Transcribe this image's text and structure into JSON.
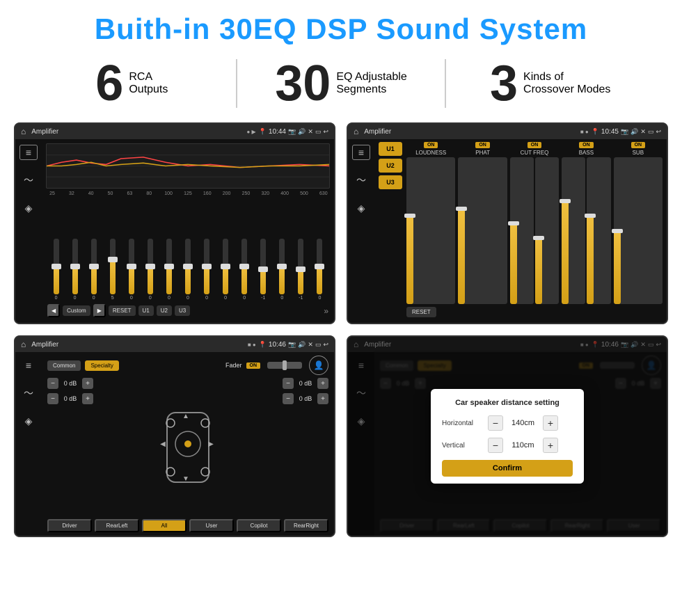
{
  "header": {
    "title": "Buith-in 30EQ DSP Sound System"
  },
  "stats": [
    {
      "number": "6",
      "text_line1": "RCA",
      "text_line2": "Outputs"
    },
    {
      "number": "30",
      "text_line1": "EQ Adjustable",
      "text_line2": "Segments"
    },
    {
      "number": "3",
      "text_line1": "Kinds of",
      "text_line2": "Crossover Modes"
    }
  ],
  "screens": {
    "top_left": {
      "title": "Amplifier",
      "time": "10:44",
      "eq_freqs": [
        "25",
        "32",
        "40",
        "50",
        "63",
        "80",
        "100",
        "125",
        "160",
        "200",
        "250",
        "320",
        "400",
        "500",
        "630"
      ],
      "eq_values": [
        "0",
        "0",
        "0",
        "5",
        "0",
        "0",
        "0",
        "0",
        "0",
        "0",
        "0",
        "-1",
        "0",
        "-1",
        "0"
      ],
      "buttons": [
        "Custom",
        "RESET",
        "U1",
        "U2",
        "U3"
      ]
    },
    "top_right": {
      "title": "Amplifier",
      "time": "10:45",
      "presets": [
        "U1",
        "U2",
        "U3"
      ],
      "panels": [
        {
          "on": true,
          "label": "LOUDNESS"
        },
        {
          "on": true,
          "label": "PHAT"
        },
        {
          "on": true,
          "label": "CUT FREQ"
        },
        {
          "on": true,
          "label": "BASS"
        },
        {
          "on": true,
          "label": "SUB"
        }
      ],
      "reset_btn": "RESET"
    },
    "bottom_left": {
      "title": "Amplifier",
      "time": "10:46",
      "tabs": [
        "Common",
        "Specialty"
      ],
      "active_tab": "Specialty",
      "fader_label": "Fader",
      "fader_on": "ON",
      "vol_rows": [
        {
          "label": "0 dB"
        },
        {
          "label": "0 dB"
        },
        {
          "label": "0 dB"
        },
        {
          "label": "0 dB"
        }
      ],
      "bottom_btns": [
        "Driver",
        "RearLeft",
        "All",
        "Copilot",
        "RearRight",
        "User"
      ]
    },
    "bottom_right": {
      "title": "Amplifier",
      "time": "10:46",
      "tabs": [
        "Common",
        "Specialty"
      ],
      "dialog": {
        "title": "Car speaker distance setting",
        "horizontal_label": "Horizontal",
        "horizontal_value": "140cm",
        "vertical_label": "Vertical",
        "vertical_value": "110cm",
        "confirm_btn": "Confirm"
      },
      "vol_rows": [
        {
          "label": "0 dB"
        },
        {
          "label": "0 dB"
        }
      ],
      "bottom_btns": [
        "Driver",
        "RearLeft",
        "Copilot",
        "RearRight",
        "User"
      ]
    }
  }
}
